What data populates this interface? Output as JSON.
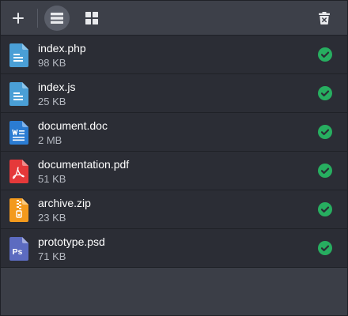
{
  "toolbar": {
    "add": "plus-icon",
    "list_view": "list-view-icon",
    "grid_view": "grid-view-icon",
    "clear": "trash-icon"
  },
  "colors": {
    "toolbar_bg": "#3d4049",
    "row_bg": "#2b2d35",
    "panel_bg": "#3b3e47",
    "status_ok": "#27ae60"
  },
  "files": [
    {
      "name": "index.php",
      "size": "98 KB",
      "type": "text",
      "icon": "document-icon",
      "color": "#4a9fd6",
      "status": "uploaded"
    },
    {
      "name": "index.js",
      "size": "25 KB",
      "type": "text",
      "icon": "document-icon",
      "color": "#4a9fd6",
      "status": "uploaded"
    },
    {
      "name": "document.doc",
      "size": "2 MB",
      "type": "word",
      "icon": "word-document-icon",
      "color": "#2b7cd3",
      "status": "uploaded"
    },
    {
      "name": "documentation.pdf",
      "size": "51 KB",
      "type": "pdf",
      "icon": "pdf-icon",
      "color": "#e5393a",
      "status": "uploaded"
    },
    {
      "name": "archive.zip",
      "size": "23 KB",
      "type": "zip",
      "icon": "zip-archive-icon",
      "color": "#f39a1d",
      "status": "uploaded"
    },
    {
      "name": "prototype.psd",
      "size": "71 KB",
      "type": "psd",
      "icon": "photoshop-file-icon",
      "color": "#5c6bc0",
      "status": "uploaded"
    }
  ]
}
